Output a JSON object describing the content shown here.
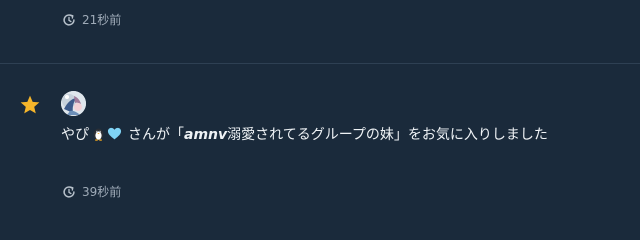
{
  "notifications": [
    {
      "time": "21秒前"
    },
    {
      "user_name": "やぴ",
      "user_emojis": [
        "penguin-emoji",
        "light-blue-heart-emoji"
      ],
      "message_after_user": "さんが「",
      "board_title_bold": "amnv",
      "board_title_rest": "溺愛されてるグループの妹",
      "message_after_title": "」をお気に入りしました",
      "time": "39秒前",
      "icon": "star-icon"
    }
  ],
  "colors": {
    "background": "#1a2a3b",
    "divider": "#2e4053",
    "star": "#f5b52a",
    "heart": "#7fd3f5",
    "muted_text": "#9fabb8"
  }
}
